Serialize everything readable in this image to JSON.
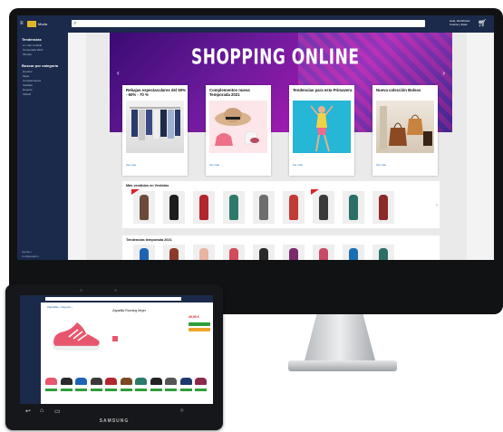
{
  "monitor": {
    "sidebar": {
      "brand": "Moda",
      "section1_title": "Tendencias",
      "section1_items": [
        "Lo más vendido",
        "Temporada 2021",
        "Ofertas"
      ],
      "section2_title": "Buscar por categoría",
      "section2_items": [
        "Hombre",
        "Mujer",
        "Complementos",
        "Calzado",
        "Deporte",
        "Infantil"
      ],
      "footer": [
        "Ayuda y",
        "Configuración"
      ]
    },
    "topbar": {
      "account_line1": "Hola, Identifícate",
      "account_line2": "Cuenta y listas"
    },
    "hero": {
      "title": "SHOPPING ONLINE"
    },
    "cards": [
      {
        "title": "Rebajas espectaculares del 50% - 60% - 70 %",
        "link": "Ver más"
      },
      {
        "title": "Complementos nueva Temporada 2021",
        "link": "Ver más"
      },
      {
        "title": "Tendencias para esta Primavera",
        "link": "Ver más"
      },
      {
        "title": "Nueva colección Bolsos",
        "link": "Ver más"
      }
    ],
    "strip1": {
      "title": "Más vendidos en Vestidos"
    },
    "strip2": {
      "title": "Tendencias temporada 2021"
    }
  },
  "tablet": {
    "breadcrumb": "Zapatillas › Deporte ›",
    "product_title": "Zapatilla Running Mujer",
    "price": "49,99 €",
    "brand": "SAMSUNG"
  },
  "colors": {
    "nav_dark": "#1b2a4a",
    "accent_green": "#2e9e3a",
    "deal_red": "#d8232a",
    "hero_purple": "#6a1a9a"
  }
}
